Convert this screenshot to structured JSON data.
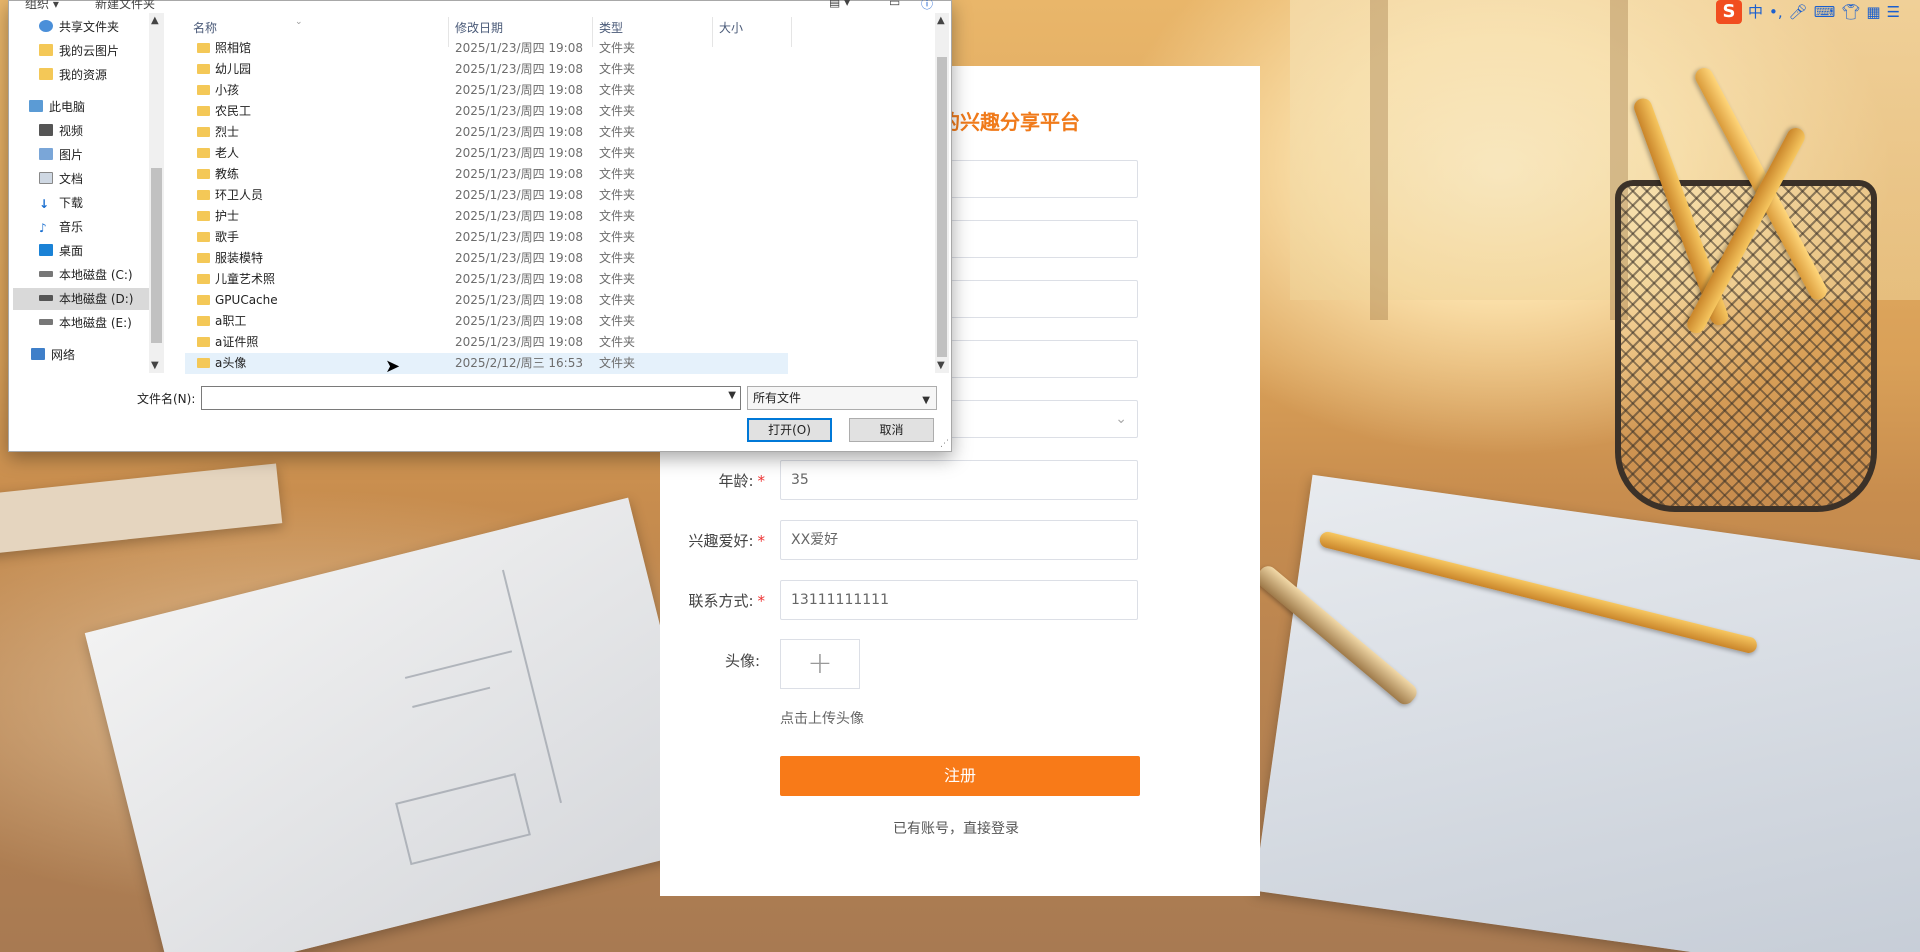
{
  "dialog": {
    "toolbar": {
      "organize": "组织 ▾",
      "new_folder": "新建文件夹"
    },
    "nav_items": [
      {
        "label": "共享文件夹",
        "icon": "shared-folder-icon"
      },
      {
        "label": "我的云图片",
        "icon": "folder-icon"
      },
      {
        "label": "我的资源",
        "icon": "folder-icon"
      },
      {
        "label": "此电脑",
        "icon": "computer-icon"
      },
      {
        "label": "视频",
        "icon": "video-icon"
      },
      {
        "label": "图片",
        "icon": "picture-icon"
      },
      {
        "label": "文档",
        "icon": "document-icon"
      },
      {
        "label": "下载",
        "icon": "download-icon"
      },
      {
        "label": "音乐",
        "icon": "music-icon"
      },
      {
        "label": "桌面",
        "icon": "desktop-icon"
      },
      {
        "label": "本地磁盘 (C:)",
        "icon": "drive-icon"
      },
      {
        "label": "本地磁盘 (D:)",
        "icon": "drive-icon",
        "selected": true
      },
      {
        "label": "本地磁盘 (E:)",
        "icon": "drive-icon"
      },
      {
        "label": "网络",
        "icon": "network-icon"
      }
    ],
    "columns": {
      "name": "名称",
      "modified": "修改日期",
      "type": "类型",
      "size": "大小"
    },
    "files": [
      {
        "name": "照相馆",
        "date": "2025/1/23/周四 19:08",
        "type": "文件夹"
      },
      {
        "name": "幼儿园",
        "date": "2025/1/23/周四 19:08",
        "type": "文件夹"
      },
      {
        "name": "小孩",
        "date": "2025/1/23/周四 19:08",
        "type": "文件夹"
      },
      {
        "name": "农民工",
        "date": "2025/1/23/周四 19:08",
        "type": "文件夹"
      },
      {
        "name": "烈士",
        "date": "2025/1/23/周四 19:08",
        "type": "文件夹"
      },
      {
        "name": "老人",
        "date": "2025/1/23/周四 19:08",
        "type": "文件夹"
      },
      {
        "name": "教练",
        "date": "2025/1/23/周四 19:08",
        "type": "文件夹"
      },
      {
        "name": "环卫人员",
        "date": "2025/1/23/周四 19:08",
        "type": "文件夹"
      },
      {
        "name": "护士",
        "date": "2025/1/23/周四 19:08",
        "type": "文件夹"
      },
      {
        "name": "歌手",
        "date": "2025/1/23/周四 19:08",
        "type": "文件夹"
      },
      {
        "name": "服装模特",
        "date": "2025/1/23/周四 19:08",
        "type": "文件夹"
      },
      {
        "name": "儿童艺术照",
        "date": "2025/1/23/周四 19:08",
        "type": "文件夹"
      },
      {
        "name": "GPUCache",
        "date": "2025/1/23/周四 19:08",
        "type": "文件夹"
      },
      {
        "name": "a职工",
        "date": "2025/1/23/周四 19:08",
        "type": "文件夹"
      },
      {
        "name": "a证件照",
        "date": "2025/1/23/周四 19:08",
        "type": "文件夹"
      },
      {
        "name": "a头像",
        "date": "2025/2/12/周三 16:53",
        "type": "文件夹",
        "selected": true
      }
    ],
    "filename_label": "文件名(N):",
    "filename_value": "",
    "filetype_value": "所有文件",
    "open_label": "打开(O)",
    "cancel_label": "取消"
  },
  "register": {
    "title": "的兴趣分享平台",
    "age_label": "年龄:",
    "age_value": "35",
    "hobby_label": "兴趣爱好:",
    "hobby_value": "XX爱好",
    "contact_label": "联系方式:",
    "contact_value": "13111111111",
    "avatar_label": "头像:",
    "upload_plus": "+",
    "upload_hint": "点击上传头像",
    "submit_label": "注册",
    "login_link": "已有账号，直接登录"
  },
  "ime": {
    "logo": "S",
    "mode": "中"
  },
  "colors": {
    "accent": "#f87a18",
    "title": "#f07a1a",
    "required": "#e33333",
    "selection": "#e5f1fb"
  }
}
